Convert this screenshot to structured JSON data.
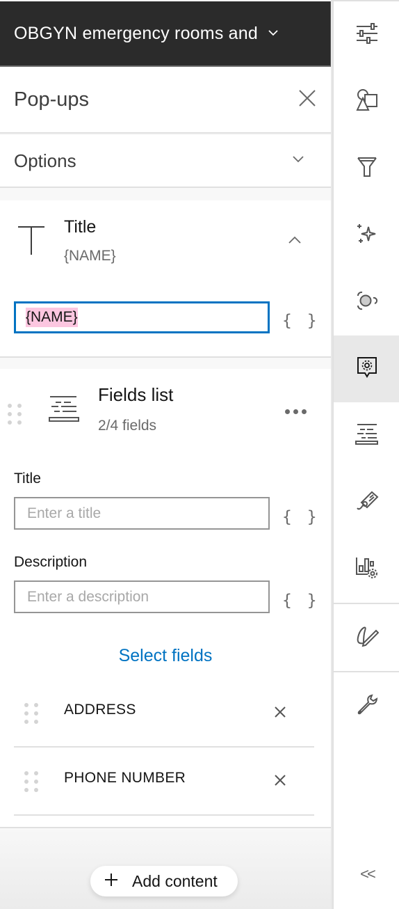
{
  "header": {
    "layer_title": "OBGYN emergency rooms and",
    "chevron_icon": "chevron-down-icon"
  },
  "popups": {
    "title": "Pop-ups",
    "close_icon": "close-icon"
  },
  "options": {
    "label": "Options",
    "chevron_icon": "chevron-down-icon"
  },
  "title_block": {
    "heading": "Title",
    "summary": "{NAME}",
    "input_value": "{NAME}",
    "expression_button": "{ }",
    "icon": "text-t-icon",
    "collapse_icon": "chevron-up-icon"
  },
  "fields_list": {
    "heading": "Fields list",
    "count": "2/4 fields",
    "icon": "fields-list-icon",
    "more_icon": "ellipsis-icon",
    "title_label": "Title",
    "title_placeholder": "Enter a title",
    "description_label": "Description",
    "description_placeholder": "Enter a description",
    "expression_button": "{ }",
    "select_fields": "Select fields",
    "fields": [
      {
        "name": "ADDRESS"
      },
      {
        "name": "PHONE NUMBER"
      }
    ]
  },
  "footer": {
    "add_content": "Add content",
    "plus_icon": "plus-icon"
  },
  "rail": {
    "items": [
      {
        "name": "properties",
        "icon": "sliders-icon"
      },
      {
        "name": "styles",
        "icon": "shapes-icon"
      },
      {
        "name": "filter",
        "icon": "filter-icon"
      },
      {
        "name": "effects",
        "icon": "sparkles-icon"
      },
      {
        "name": "clustering",
        "icon": "cluster-icon"
      },
      {
        "name": "configure-pop-ups",
        "icon": "popup-gear-icon",
        "active": true
      },
      {
        "name": "fields",
        "icon": "fields-list-icon"
      },
      {
        "name": "labels",
        "icon": "tag-icon"
      },
      {
        "name": "configure-charts",
        "icon": "chart-gear-icon"
      },
      {
        "name": "sketch",
        "icon": "pencil-sketch-icon"
      },
      {
        "name": "tools",
        "icon": "wrench-icon"
      }
    ],
    "collapse_label": "<<"
  },
  "colors": {
    "accent": "#0073c2",
    "header_bg": "#2b2b2b",
    "highlight": "#fcc6e0",
    "active_rail": "#e8e8e8"
  }
}
